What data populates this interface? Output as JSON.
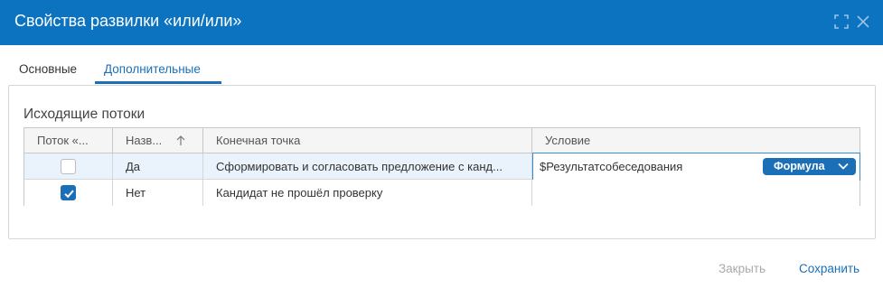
{
  "window": {
    "title": "Свойства развилки «или/или»",
    "accent": "#0b73c0"
  },
  "tabs": [
    {
      "label": "Основные",
      "active": false
    },
    {
      "label": "Дополнительные",
      "active": true
    }
  ],
  "section": {
    "title": "Исходящие потоки"
  },
  "table": {
    "columns": [
      "Поток «...",
      "Назв...",
      "Конечная точка",
      "Условие"
    ],
    "sort_icon": "arrow-up-icon",
    "rows": [
      {
        "checked": false,
        "name": "Да",
        "endpoint": "Сформировать и согласовать предложение с канд...",
        "condition": "$Результатсобеседования",
        "condition_mode": "Формула"
      },
      {
        "checked": true,
        "name": "Нет",
        "endpoint": "Кандидат не прошёл проверку",
        "condition": ""
      }
    ]
  },
  "footer": {
    "close_label": "Закрыть",
    "save_label": "Сохранить"
  }
}
